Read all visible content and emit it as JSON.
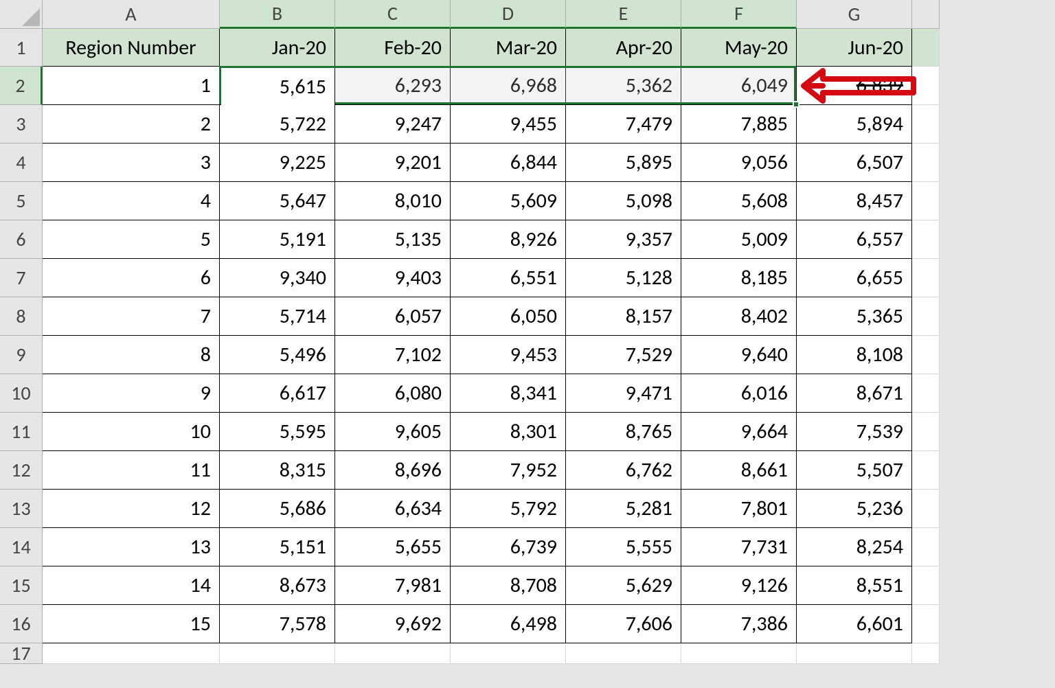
{
  "columns": [
    "A",
    "B",
    "C",
    "D",
    "E",
    "F",
    "G"
  ],
  "row_numbers": [
    "1",
    "2",
    "3",
    "4",
    "5",
    "6",
    "7",
    "8",
    "9",
    "10",
    "11",
    "12",
    "13",
    "14",
    "15",
    "16",
    "17"
  ],
  "headers": {
    "A": "Region Number",
    "B": "Jan-20",
    "C": "Feb-20",
    "D": "Mar-20",
    "E": "Apr-20",
    "F": "May-20",
    "G": "Jun-20"
  },
  "data_rows": [
    {
      "A": "1",
      "B": "5,615",
      "C": "6,293",
      "D": "6,968",
      "E": "5,362",
      "F": "6,049",
      "G": "6,839"
    },
    {
      "A": "2",
      "B": "5,722",
      "C": "9,247",
      "D": "9,455",
      "E": "7,479",
      "F": "7,885",
      "G": "5,894"
    },
    {
      "A": "3",
      "B": "9,225",
      "C": "9,201",
      "D": "6,844",
      "E": "5,895",
      "F": "9,056",
      "G": "6,507"
    },
    {
      "A": "4",
      "B": "5,647",
      "C": "8,010",
      "D": "5,609",
      "E": "5,098",
      "F": "5,608",
      "G": "8,457"
    },
    {
      "A": "5",
      "B": "5,191",
      "C": "5,135",
      "D": "8,926",
      "E": "9,357",
      "F": "5,009",
      "G": "6,557"
    },
    {
      "A": "6",
      "B": "9,340",
      "C": "9,403",
      "D": "6,551",
      "E": "5,128",
      "F": "8,185",
      "G": "6,655"
    },
    {
      "A": "7",
      "B": "5,714",
      "C": "6,057",
      "D": "6,050",
      "E": "8,157",
      "F": "8,402",
      "G": "5,365"
    },
    {
      "A": "8",
      "B": "5,496",
      "C": "7,102",
      "D": "9,453",
      "E": "7,529",
      "F": "9,640",
      "G": "8,108"
    },
    {
      "A": "9",
      "B": "6,617",
      "C": "6,080",
      "D": "8,341",
      "E": "9,471",
      "F": "6,016",
      "G": "8,671"
    },
    {
      "A": "10",
      "B": "5,595",
      "C": "9,605",
      "D": "8,301",
      "E": "8,765",
      "F": "9,664",
      "G": "7,539"
    },
    {
      "A": "11",
      "B": "8,315",
      "C": "8,696",
      "D": "7,952",
      "E": "6,762",
      "F": "8,661",
      "G": "5,507"
    },
    {
      "A": "12",
      "B": "5,686",
      "C": "6,634",
      "D": "5,792",
      "E": "5,281",
      "F": "7,801",
      "G": "5,236"
    },
    {
      "A": "13",
      "B": "5,151",
      "C": "5,655",
      "D": "6,739",
      "E": "5,555",
      "F": "7,731",
      "G": "8,254"
    },
    {
      "A": "14",
      "B": "8,673",
      "C": "7,981",
      "D": "8,708",
      "E": "5,629",
      "F": "9,126",
      "G": "8,551"
    },
    {
      "A": "15",
      "B": "7,578",
      "C": "9,692",
      "D": "6,498",
      "E": "7,606",
      "F": "7,386",
      "G": "6,601"
    }
  ],
  "selection": {
    "row": 2,
    "start_col": "B",
    "end_col": "F",
    "active_col": "B"
  },
  "annotation": {
    "type": "arrow",
    "color": "#d40b12"
  },
  "layout": {
    "row_header_w": 62,
    "col_header_h": 42,
    "col_widths": {
      "A": 258,
      "B": 168,
      "C": 168,
      "D": 168,
      "E": 168,
      "F": 168,
      "G": 168
    },
    "row_heights": {
      "1": 55,
      "default": 56,
      "17": 30
    }
  }
}
